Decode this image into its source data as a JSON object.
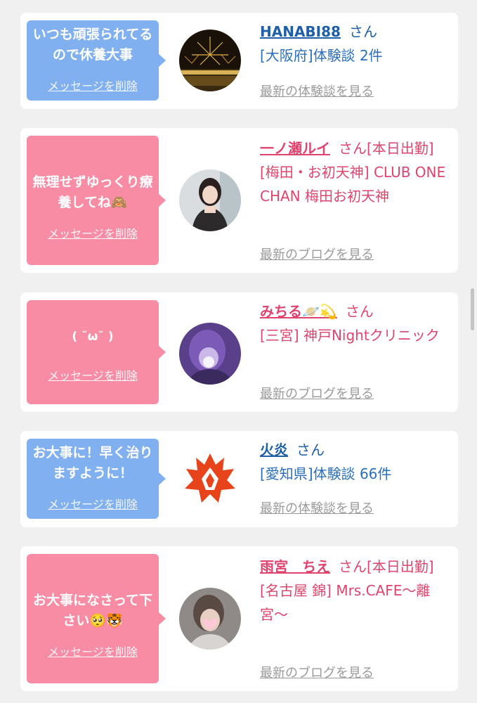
{
  "cards": [
    {
      "message": "いつも頑張られてるので休養大事",
      "delete_label": "メッセージを削除",
      "name": "HANABI88",
      "honorific": "さん",
      "detail_lines": [
        "[大阪府]体験談 2件"
      ],
      "latest_link": "最新の体験談を見る",
      "theme": "blue"
    },
    {
      "message": "無理せずゆっくり療養してね🙈",
      "delete_label": "メッセージを削除",
      "name": "一ノ瀬ルイ",
      "honorific": "さん[本日出勤]",
      "detail_lines": [
        "[梅田・お初天神] CLUB ONE CHAN 梅田お初天神"
      ],
      "latest_link": "最新のブログを見る",
      "theme": "pink"
    },
    {
      "message": "( ˘ω˘ )",
      "delete_label": "メッセージを削除",
      "name": "みちる🪐💫",
      "honorific": "さん",
      "detail_lines": [
        "[三宮] 神戸Nightクリニック"
      ],
      "latest_link": "最新のブログを見る",
      "theme": "pink"
    },
    {
      "message": "お大事に！早く治りますように！",
      "delete_label": "メッセージを削除",
      "name": "火炎",
      "honorific": "さん",
      "detail_lines": [
        "[愛知県]体験談 66件"
      ],
      "latest_link": "最新の体験談を見る",
      "theme": "blue"
    },
    {
      "message": "お大事になさって下さい🥺🐯",
      "delete_label": "メッセージを削除",
      "name": "雨宮　ちえ",
      "honorific": "さん[本日出勤]",
      "detail_lines": [
        "[名古屋 錦] Mrs.CAFE〜離宮〜"
      ],
      "latest_link": "最新のブログを見る",
      "theme": "pink"
    }
  ],
  "avatars": [
    "fireworks-avatar",
    "woman-photo-avatar",
    "purple-photo-avatar",
    "flame-logo-avatar",
    "blurred-photo-avatar"
  ]
}
